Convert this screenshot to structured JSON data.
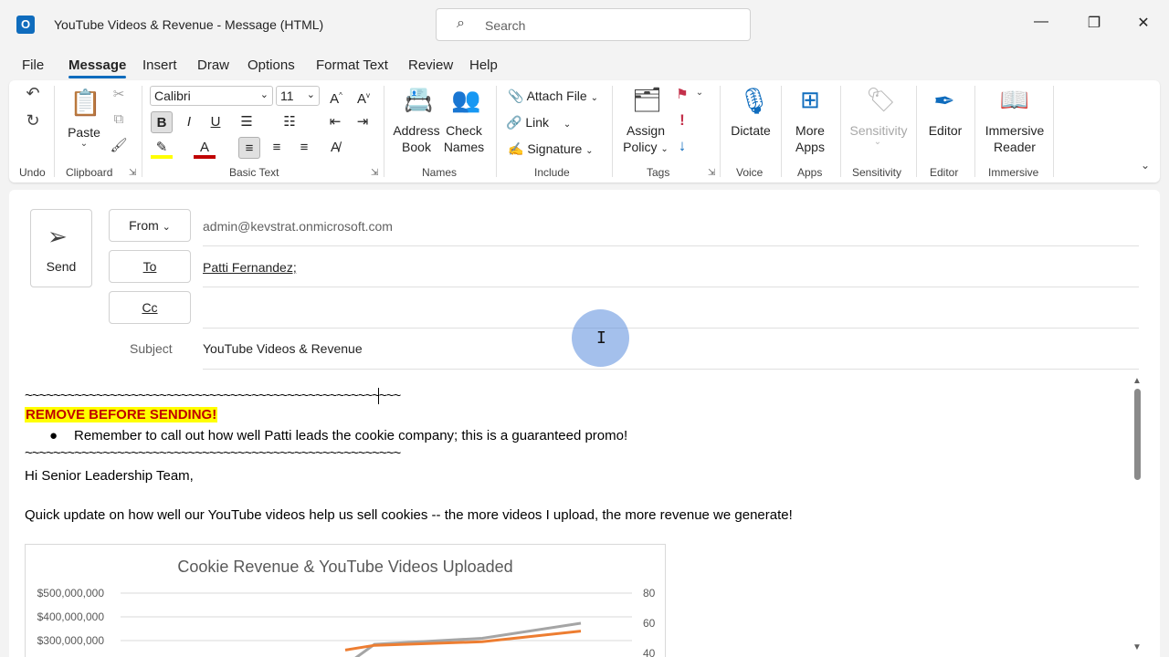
{
  "window": {
    "title": "YouTube Videos & Revenue  -  Message (HTML)",
    "search_placeholder": "Search"
  },
  "menu": {
    "tabs": [
      "File",
      "Message",
      "Insert",
      "Draw",
      "Options",
      "Format Text",
      "Review",
      "Help"
    ],
    "active": "Message"
  },
  "ribbon": {
    "groups": {
      "undo": "Undo",
      "clipboard": "Clipboard",
      "basic_text": "Basic Text",
      "names": "Names",
      "include": "Include",
      "tags": "Tags",
      "voice": "Voice",
      "apps": "Apps",
      "sensitivity": "Sensitivity",
      "editor": "Editor",
      "immersive": "Immersive"
    },
    "paste": "Paste",
    "font_name": "Calibri",
    "font_size": "11",
    "address_book": [
      "Address",
      "Book"
    ],
    "check_names": [
      "Check",
      "Names"
    ],
    "attach_file": "Attach File",
    "link": "Link",
    "signature": "Signature",
    "assign_policy": [
      "Assign",
      "Policy"
    ],
    "dictate": "Dictate",
    "more_apps": [
      "More",
      "Apps"
    ],
    "sensitivity": "Sensitivity",
    "editor": "Editor",
    "immersive_reader": [
      "Immersive",
      "Reader"
    ]
  },
  "compose": {
    "send": "Send",
    "from_label": "From",
    "from_value": "admin@kevstrat.onmicrosoft.com",
    "to_label": "To",
    "to_value": "Patti Fernandez;",
    "cc_label": "Cc",
    "subject_label": "Subject",
    "subject_value": "YouTube Videos & Revenue"
  },
  "body": {
    "tilde_line": "~~~~~~~~~~~~~~~~~~~~~~~~~~~~~~~~~~~~~~~~~~~~~~~~~~~~~",
    "warning": "REMOVE BEFORE SENDING!",
    "bullet": "Remember to call out how well Patti leads the cookie company; this is a guaranteed promo!",
    "greeting": "Hi Senior Leadership Team,",
    "paragraph": "Quick update on how well our YouTube videos help us sell cookies -- the more videos I upload, the more revenue we generate!"
  },
  "chart_data": {
    "type": "line",
    "title": "Cookie Revenue & YouTube Videos Uploaded",
    "y_left_ticks": [
      "$500,000,000",
      "$400,000,000",
      "$300,000,000"
    ],
    "y_right_ticks": [
      "80",
      "60",
      "40"
    ],
    "series": [
      {
        "color": "#a5a5a5",
        "axis": "right",
        "values": [
          32,
          46,
          50,
          60
        ]
      },
      {
        "color": "#ed7d31",
        "axis": "left",
        "values": [
          260000000,
          280000000,
          295000000,
          340000000
        ]
      }
    ]
  }
}
